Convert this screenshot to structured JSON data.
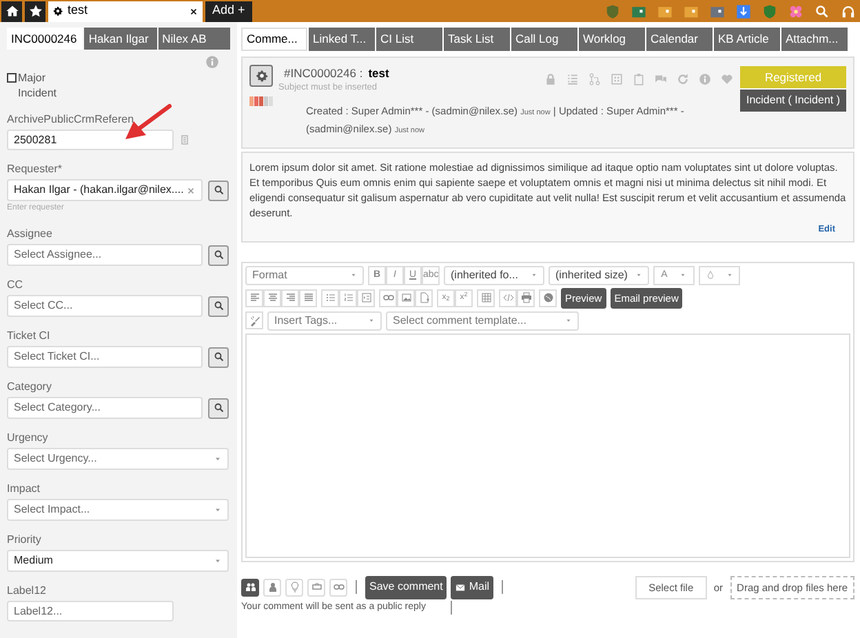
{
  "top_bar": {
    "tabs": [
      {
        "label": "test",
        "selected": true
      }
    ],
    "add_button": "Add +"
  },
  "left_panel": {
    "tabs": [
      {
        "label": "INC0000246",
        "selected": true
      },
      {
        "label": "Hakan Ilgar",
        "selected": false
      },
      {
        "label": "Nilex AB",
        "selected": false
      }
    ],
    "major_incident": {
      "label": "Major Incident",
      "checked": false
    },
    "fields": [
      {
        "kind": "text",
        "label": "ArchivePublicCrmReferen",
        "value": "2500281"
      },
      {
        "kind": "lookup",
        "label": "Requester*",
        "value": "Hakan Ilgar - (hakan.ilgar@nilex....",
        "hint": "Enter requester"
      },
      {
        "kind": "lookup",
        "label": "Assignee",
        "placeholder": "Select Assignee..."
      },
      {
        "kind": "lookup",
        "label": "CC",
        "placeholder": "Select CC..."
      },
      {
        "kind": "lookup",
        "label": "Ticket CI",
        "placeholder": "Select Ticket CI..."
      },
      {
        "kind": "lookup",
        "label": "Category",
        "placeholder": "Select Category..."
      },
      {
        "kind": "select",
        "label": "Urgency",
        "placeholder": "Select Urgency..."
      },
      {
        "kind": "select",
        "label": "Impact",
        "placeholder": "Select Impact..."
      },
      {
        "kind": "select",
        "label": "Priority",
        "value": "Medium"
      },
      {
        "kind": "text",
        "label": "Label12",
        "placeholder": "Label12..."
      }
    ]
  },
  "main_tabs": [
    {
      "label": "Comme...",
      "selected": true
    },
    {
      "label": "Linked T...",
      "selected": false
    },
    {
      "label": "CI List",
      "selected": false
    },
    {
      "label": "Task List",
      "selected": false
    },
    {
      "label": "Call Log",
      "selected": false
    },
    {
      "label": "Worklog",
      "selected": false
    },
    {
      "label": "Calendar",
      "selected": false
    },
    {
      "label": "KB Article",
      "selected": false
    },
    {
      "label": "Attachm...",
      "selected": false
    }
  ],
  "ticket": {
    "number": "#INC0000246 :",
    "subject": "test",
    "hint": "Subject must be inserted",
    "meta": [
      {
        "kind": "text",
        "text": "Created : Super Admin*** - (sadmin@nilex.se)"
      },
      {
        "kind": "time",
        "text": "Just now"
      },
      {
        "kind": "text",
        "text": "| Updated : Super Admin*** - (sadmin@nilex.se)"
      },
      {
        "kind": "time",
        "text": "Just now"
      }
    ],
    "status": "Registered",
    "type": "Incident ( Incident )"
  },
  "description": {
    "text": "Lorem ipsum dolor sit amet. Sit ratione molestiae ad dignissimos similique ad itaque optio nam voluptates sint ut dolore voluptas. Et temporibus Quis eum omnis enim qui sapiente saepe et voluptatem omnis et magni nisi ut minima delectus sit nihil modi. Et eligendi consequatur sit galisum aspernatur ab vero cupiditate aut velit nulla! Est suscipit rerum et velit accusantium et assumenda deserunt.",
    "edit": "Edit"
  },
  "editor": {
    "format": "Format",
    "style_buttons": [
      "B",
      "I",
      "U",
      "abc"
    ],
    "font": "(inherited fo...",
    "size": "(inherited size)",
    "color_button": "A",
    "script_buttons": [
      "x$_{2}$",
      "x$^{2}$"
    ],
    "preview": "Preview",
    "email_preview": "Email preview",
    "tags_placeholder": "Insert Tags...",
    "template_placeholder": "Select comment template..."
  },
  "footer": {
    "visibility": [
      {
        "kind": "group",
        "selected": true
      },
      {
        "kind": "person",
        "selected": false
      },
      {
        "kind": "bulb",
        "selected": false
      },
      {
        "kind": "tag",
        "selected": false
      },
      {
        "kind": "link",
        "selected": false
      }
    ],
    "save": "Save comment",
    "mail": "Mail",
    "note": "Your comment will be sent as a public reply",
    "select_file": "Select file",
    "or": "or",
    "drop": "Drag and drop files here"
  }
}
